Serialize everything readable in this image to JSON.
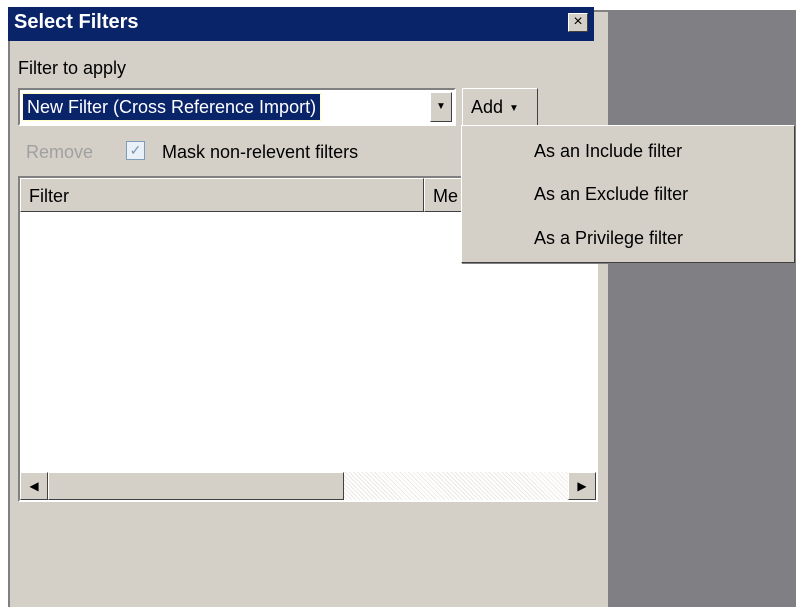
{
  "window": {
    "title": "Select Filters",
    "close_glyph": "×"
  },
  "filter_section": {
    "label": "Filter to apply",
    "selected_filter": "New Filter (Cross Reference Import)",
    "add_label": "Add"
  },
  "actions": {
    "remove_label": "Remove",
    "mask_label": "Mask non-relevent filters",
    "mask_checked": true
  },
  "table": {
    "columns": [
      "Filter",
      "Me"
    ]
  },
  "add_menu": {
    "items": [
      "As an Include filter",
      "As an Exclude filter",
      "As a Privilege filter"
    ]
  },
  "icons": {
    "close": "close-icon",
    "dropdown": "chevron-down-icon",
    "scroll_left": "arrow-left-icon",
    "scroll_right": "arrow-right-icon"
  },
  "colors": {
    "titlebar": "#0a246a",
    "panel": "#d4d0c8",
    "background_area": "#807f83",
    "selection": "#0a246a"
  }
}
